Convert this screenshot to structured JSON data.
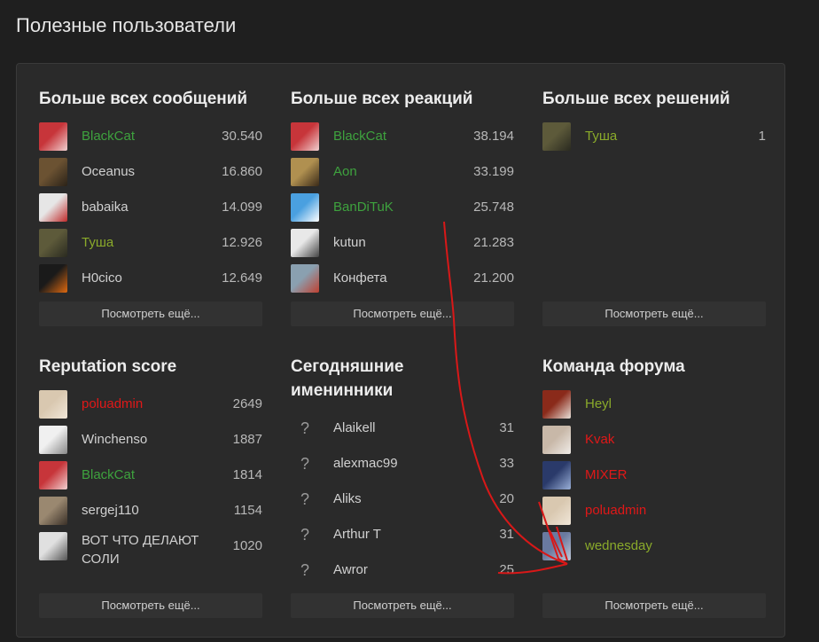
{
  "page_title": "Полезные пользователи",
  "blocks": [
    {
      "title": "Больше всех сообщений",
      "more": "Посмотреть ещё...",
      "users": [
        {
          "name": "BlackCat",
          "value": "30.540",
          "color": "#3ea23e",
          "avatar": [
            "#c7353a",
            "#f0d0d0"
          ]
        },
        {
          "name": "Oceanus",
          "value": "16.860",
          "color": "#d0d0d0",
          "avatar": [
            "#6b5232",
            "#2b2218"
          ]
        },
        {
          "name": "babaika",
          "value": "14.099",
          "color": "#d0d0d0",
          "avatar": [
            "#e6e6e6",
            "#c02a2a"
          ]
        },
        {
          "name": "Туша",
          "value": "12.926",
          "color": "#8aaa2a",
          "avatar": [
            "#5d5a3a",
            "#2a2a20"
          ]
        },
        {
          "name": "H0cico",
          "value": "12.649",
          "color": "#d0d0d0",
          "avatar": [
            "#1a1a1a",
            "#e06a10"
          ]
        }
      ]
    },
    {
      "title": "Больше всех реакций",
      "more": "Посмотреть ещё...",
      "users": [
        {
          "name": "BlackCat",
          "value": "38.194",
          "color": "#3ea23e",
          "avatar": [
            "#c7353a",
            "#f0d0d0"
          ]
        },
        {
          "name": "Aon",
          "value": "33.199",
          "color": "#3ea23e",
          "avatar": [
            "#b09050",
            "#3a2a18"
          ]
        },
        {
          "name": "BanDiTuK",
          "value": "25.748",
          "color": "#3ea23e",
          "avatar": [
            "#4aa0e0",
            "#ffffff"
          ]
        },
        {
          "name": "kutun",
          "value": "21.283",
          "color": "#d0d0d0",
          "avatar": [
            "#e8e8e8",
            "#444444"
          ]
        },
        {
          "name": "Конфета",
          "value": "21.200",
          "color": "#d0d0d0",
          "avatar": [
            "#8aa0b0",
            "#c04030"
          ]
        }
      ]
    },
    {
      "title": "Больше всех решений",
      "more": "Посмотреть ещё...",
      "users": [
        {
          "name": "Туша",
          "value": "1",
          "color": "#8aaa2a",
          "avatar": [
            "#5d5a3a",
            "#2a2a20"
          ]
        }
      ]
    },
    {
      "title": "Reputation score",
      "more": "Посмотреть ещё...",
      "users": [
        {
          "name": "poluadmin",
          "value": "2649",
          "color": "#e01818",
          "avatar": [
            "#d9c8b0",
            "#f0e6d8"
          ]
        },
        {
          "name": "Winchenso",
          "value": "1887",
          "color": "#d0d0d0",
          "avatar": [
            "#f0f0f0",
            "#888888"
          ]
        },
        {
          "name": "BlackCat",
          "value": "1814",
          "color": "#3ea23e",
          "avatar": [
            "#c7353a",
            "#f0d0d0"
          ]
        },
        {
          "name": "sergej110",
          "value": "1154",
          "color": "#d0d0d0",
          "avatar": [
            "#9a8870",
            "#3a3028"
          ]
        },
        {
          "name": "ВОТ ЧТО ДЕЛАЮТ СОЛИ",
          "value": "1020",
          "color": "#d0d0d0",
          "avatar": [
            "#e0e0e0",
            "#555555"
          ]
        }
      ]
    },
    {
      "title": "Сегодняшние именинники",
      "more": "Посмотреть ещё...",
      "users": [
        {
          "name": "Alaikell",
          "value": "31",
          "color": "#d0d0d0"
        },
        {
          "name": "alexmac99",
          "value": "33",
          "color": "#d0d0d0"
        },
        {
          "name": "Aliks",
          "value": "20",
          "color": "#d0d0d0"
        },
        {
          "name": "Arthur T",
          "value": "31",
          "color": "#d0d0d0"
        },
        {
          "name": "Awror",
          "value": "25",
          "color": "#d0d0d0"
        }
      ]
    },
    {
      "title": "Команда форума",
      "more": "Посмотреть ещё...",
      "users": [
        {
          "name": "Heyl",
          "value": "",
          "color": "#8aaa2a",
          "avatar": [
            "#8a2a1a",
            "#e8e0d8"
          ]
        },
        {
          "name": "Kvak",
          "value": "",
          "color": "#e01818",
          "avatar": [
            "#c8b8a8",
            "#f0ece8"
          ]
        },
        {
          "name": "MIXER",
          "value": "",
          "color": "#e01818",
          "avatar": [
            "#2a3a6a",
            "#9ab0d8"
          ]
        },
        {
          "name": "poluadmin",
          "value": "",
          "color": "#e01818",
          "avatar": [
            "#d9c8b0",
            "#f0e6d8"
          ]
        },
        {
          "name": "wednesday",
          "value": "",
          "color": "#8aaa2a",
          "avatar": [
            "#6a7aa0",
            "#c0c8d8"
          ]
        }
      ]
    }
  ],
  "icons": {
    "unknown_avatar": "?"
  }
}
